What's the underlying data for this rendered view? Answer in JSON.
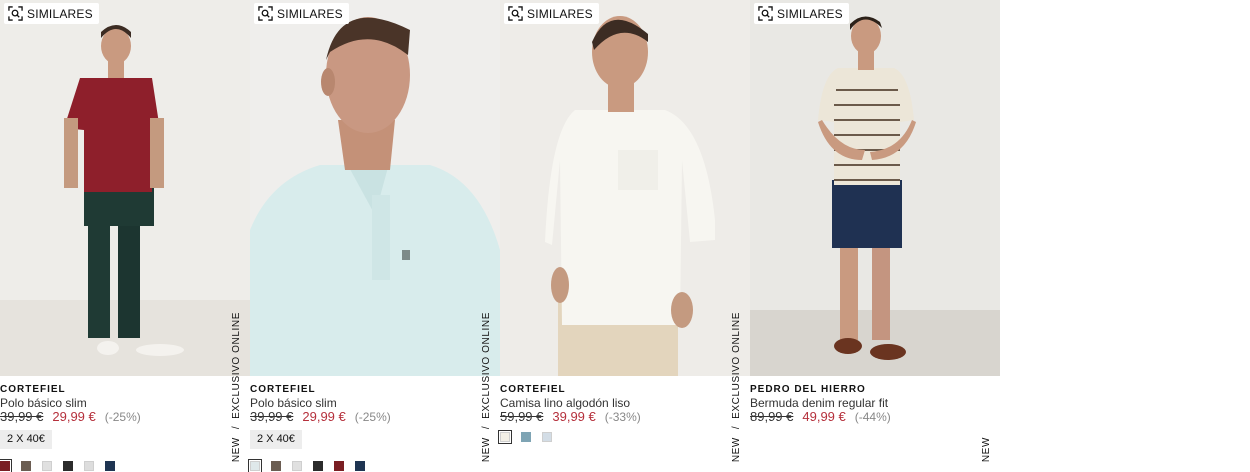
{
  "products": [
    {
      "similar_label": "SIMILARES",
      "tag_new": "NEW",
      "tag_separator": "/",
      "tag_exclusive": "EXCLUSIVO ONLINE",
      "brand": "CORTEFIEL",
      "name": "Polo básico slim",
      "old_price": "39,99 €",
      "new_price": "29,99 €",
      "discount": "(-25%)",
      "promo": "2 X 40€",
      "swatches": [
        "#7a1e23",
        "#6b5d52",
        "#e0e0e0",
        "#2b2b2b",
        "#dddddd",
        "#1f3552"
      ],
      "selected_swatch": 0
    },
    {
      "similar_label": "SIMILARES",
      "tag_new": "NEW",
      "tag_separator": "/",
      "tag_exclusive": "EXCLUSIVO ONLINE",
      "brand": "CORTEFIEL",
      "name": "Polo básico slim",
      "old_price": "39,99 €",
      "new_price": "29,99 €",
      "discount": "(-25%)",
      "promo": "2 X 40€",
      "swatches": [
        "#dfe8ea",
        "#6b5d52",
        "#e0e0e0",
        "#2b2b2b",
        "#7a1e23",
        "#1f3552"
      ],
      "selected_swatch": 0
    },
    {
      "similar_label": "SIMILARES",
      "tag_new": "NEW",
      "tag_separator": "/",
      "tag_exclusive": "EXCLUSIVO ONLINE",
      "brand": "CORTEFIEL",
      "name": "Camisa lino algodón liso",
      "old_price": "59,99 €",
      "new_price": "39,99 €",
      "discount": "(-33%)",
      "promo": "",
      "swatches": [
        "#f2efe6",
        "#7ea4b4",
        "#d3dde6"
      ],
      "selected_swatch": 0
    },
    {
      "similar_label": "SIMILARES",
      "tag_new": "NEW",
      "tag_separator": "",
      "tag_exclusive": "",
      "brand": "PEDRO DEL HIERRO",
      "name": "Bermuda denim regular fit",
      "old_price": "89,99 €",
      "new_price": "49,99 €",
      "discount": "(-44%)",
      "promo": "",
      "swatches": [],
      "selected_swatch": -1
    }
  ],
  "icons": {
    "similar": "visual-search-icon"
  }
}
